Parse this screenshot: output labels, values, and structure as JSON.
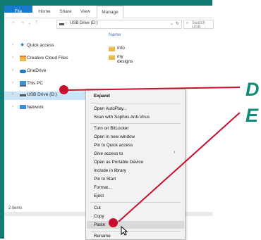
{
  "ribbon": {
    "tabs": [
      {
        "label": "File"
      },
      {
        "label": "Home"
      },
      {
        "label": "Share"
      },
      {
        "label": "View"
      },
      {
        "label": "Manage"
      }
    ]
  },
  "address": {
    "path": "USB Drive (D:)",
    "search_placeholder": "Search USB"
  },
  "nav_pane": {
    "items": [
      {
        "label": "Quick access",
        "icon": "star-icon"
      },
      {
        "label": "Creative Cloud Files",
        "icon": "folder-icon"
      },
      {
        "label": "OneDrive",
        "icon": "cloud-icon"
      },
      {
        "label": "This PC",
        "icon": "computer-icon"
      },
      {
        "label": "USB Drive (D:)",
        "icon": "drive-icon"
      },
      {
        "label": "Network",
        "icon": "network-icon"
      }
    ]
  },
  "content": {
    "column_header": "Name",
    "files": [
      {
        "label": "Info"
      },
      {
        "label": "my designs"
      }
    ]
  },
  "status": {
    "count": "2 items"
  },
  "context_menu": {
    "items": [
      "Expand",
      "Open AutoPlay...",
      "Scan with Sophos Anti-Virus",
      "Turn on BitLocker",
      "Open in new window",
      "Pin to Quick access",
      "Give access to",
      "Open as Portable Device",
      "Include in library",
      "Pin to Start",
      "Format...",
      "Eject",
      "Cut",
      "Copy",
      "Paste",
      "Rename"
    ]
  },
  "callouts": {
    "d": "D",
    "e": "E"
  },
  "colors": {
    "callout_red": "#c8102e",
    "callout_teal": "#0f8a78",
    "frame_teal": "#107a73",
    "file_tab_blue": "#1979ca"
  }
}
